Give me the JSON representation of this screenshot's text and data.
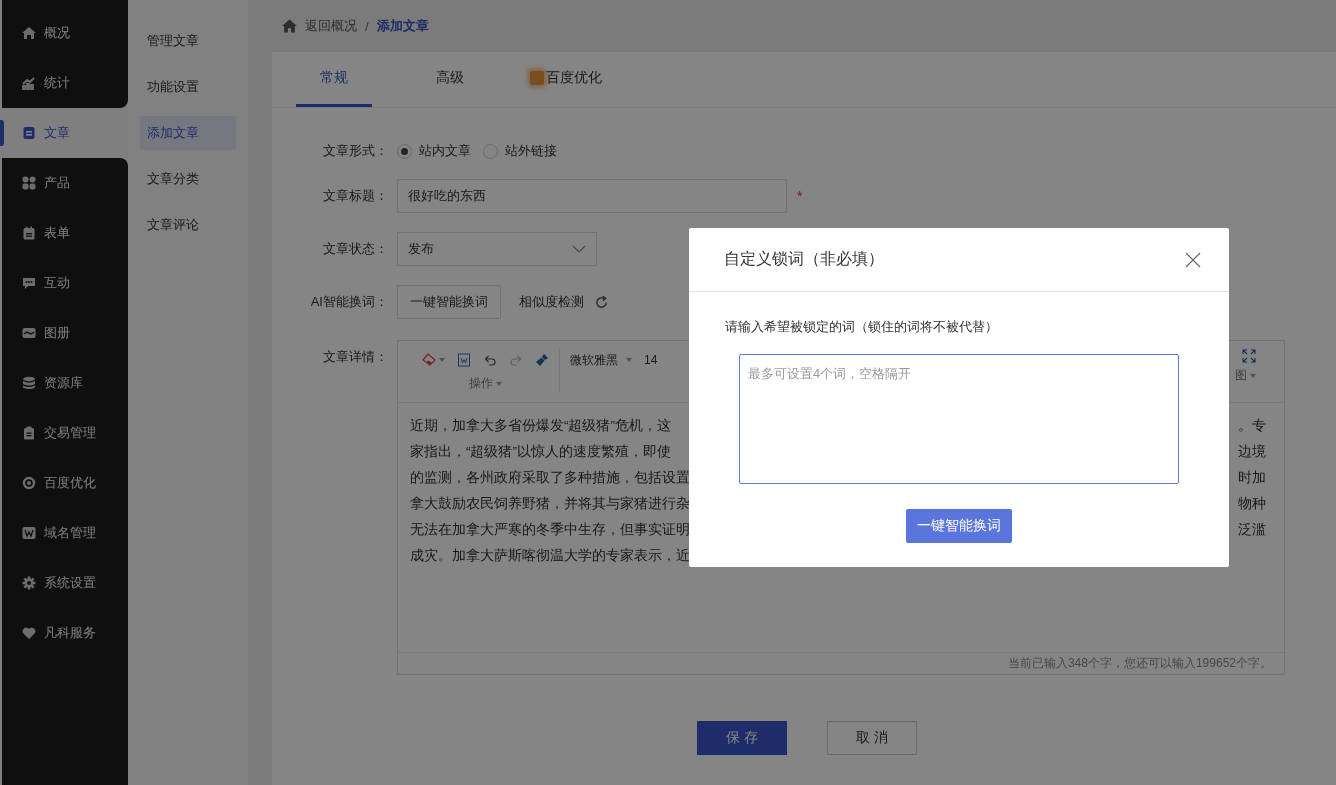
{
  "sidebar": {
    "items": [
      {
        "label": "概况",
        "selected": false
      },
      {
        "label": "统计",
        "selected": false
      },
      {
        "label": "文章",
        "selected": true
      },
      {
        "label": "产品",
        "selected": false
      },
      {
        "label": "表单",
        "selected": false
      },
      {
        "label": "互动",
        "selected": false
      },
      {
        "label": "图册",
        "selected": false
      },
      {
        "label": "资源库",
        "selected": false
      },
      {
        "label": "交易管理",
        "selected": false
      },
      {
        "label": "百度优化",
        "selected": false
      },
      {
        "label": "域名管理",
        "selected": false
      },
      {
        "label": "系统设置",
        "selected": false
      },
      {
        "label": "凡科服务",
        "selected": false
      }
    ]
  },
  "subnav": {
    "items": [
      {
        "label": "管理文章",
        "selected": false
      },
      {
        "label": "功能设置",
        "selected": false
      },
      {
        "label": "添加文章",
        "selected": true
      },
      {
        "label": "文章分类",
        "selected": false
      },
      {
        "label": "文章评论",
        "selected": false
      }
    ]
  },
  "breadcrumb": {
    "back": "返回概况",
    "separator": "/",
    "current": "添加文章"
  },
  "tabs": [
    {
      "label": "常规",
      "selected": true
    },
    {
      "label": "高级",
      "selected": false
    },
    {
      "label": "百度优化",
      "selected": false
    }
  ],
  "form": {
    "format": {
      "label": "文章形式：",
      "options": [
        {
          "label": "站内文章",
          "selected": true
        },
        {
          "label": "站外链接",
          "selected": false
        }
      ]
    },
    "title": {
      "label": "文章标题：",
      "value": "很好吃的东西",
      "required_mark": "*"
    },
    "status": {
      "label": "文章状态：",
      "value": "发布"
    },
    "ai": {
      "label": "AI智能换词：",
      "button": "一键智能换词",
      "link": "相似度检测"
    },
    "detail": {
      "label": "文章详情：",
      "toolbar": {
        "font": "微软雅黑",
        "size": "14",
        "group_left": "操作",
        "group_right": "图"
      },
      "lines": [
        {
          "left": "近期，加拿大多省份爆发“超级猪”危机，这",
          "right": "。专"
        },
        {
          "left": "家指出，“超级猪”以惊人的速度繁殖，即使",
          "right": "边境"
        },
        {
          "left": "的监测，各州政府采取了多种措施，包括设置",
          "right": "时加"
        },
        {
          "left": "拿大鼓励农民饲养野猪，并将其与家猪进行杂",
          "right": "物种"
        },
        {
          "left": "无法在加拿大严寒的冬季中生存，但事实证明",
          "right": "泛滥"
        },
        {
          "left": "成灾。加拿大萨斯喀彻温大学的专家表示，近"
        }
      ],
      "counter": "当前已输入348个字，您还可以输入199652个字。"
    }
  },
  "actions": {
    "save": "保 存",
    "cancel": "取 消"
  },
  "dialog": {
    "title": "自定义锁词（非必填）",
    "prompt": "请输入希望被锁定的词（锁住的词将不被代替）",
    "placeholder": "最多可设置4个词，空格隔开",
    "button": "一键智能换词"
  }
}
